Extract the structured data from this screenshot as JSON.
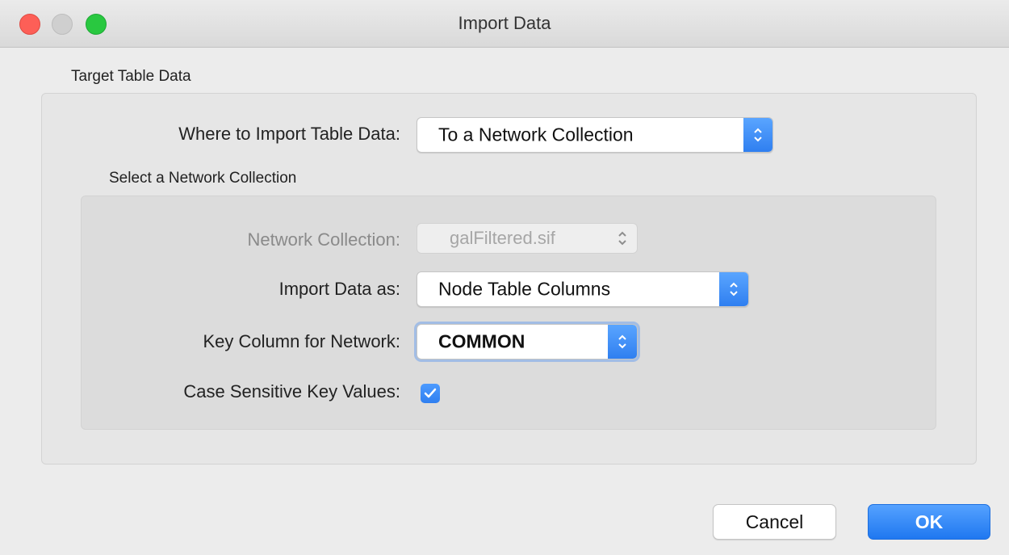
{
  "window": {
    "title": "Import Data"
  },
  "target_section": {
    "label": "Target Table Data",
    "where_label": "Where to Import Table Data:",
    "where_value": "To a Network Collection"
  },
  "collection_section": {
    "label": "Select a Network Collection",
    "network_collection_label": "Network Collection:",
    "network_collection_value": "galFiltered.sif",
    "import_as_label": "Import Data as:",
    "import_as_value": "Node Table Columns",
    "key_column_label": "Key Column for Network:",
    "key_column_value": "COMMON",
    "case_sensitive_label": "Case Sensitive Key Values:",
    "case_sensitive_checked": true
  },
  "buttons": {
    "cancel": "Cancel",
    "ok": "OK"
  },
  "colors": {
    "accent": "#2f7ff0",
    "close": "#fd5f57",
    "maximize": "#29c840"
  }
}
